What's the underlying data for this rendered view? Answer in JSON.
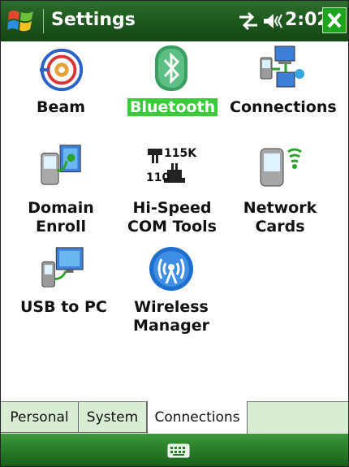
{
  "title_bar": {
    "title": "Settings",
    "clock": "2:02",
    "close_label": "X",
    "icons": [
      "windows-start-icon",
      "connectivity-icon",
      "volume-icon",
      "close-icon"
    ]
  },
  "items": [
    {
      "label_lines": [
        "Beam"
      ],
      "icon": "beam-icon"
    },
    {
      "label_lines": [
        "Bluetooth"
      ],
      "icon": "bluetooth-icon",
      "selected": true
    },
    {
      "label_lines": [
        "Connections"
      ],
      "icon": "connections-icon"
    },
    {
      "label_lines": [
        "Domain",
        "Enroll"
      ],
      "icon": "domain-enroll-icon"
    },
    {
      "label_lines": [
        "Hi-Speed",
        "COM Tools"
      ],
      "icon": "hi-speed-com-tools-icon",
      "icon_text": [
        "115K",
        "110"
      ]
    },
    {
      "label_lines": [
        "Network",
        "Cards"
      ],
      "icon": "network-cards-icon"
    },
    {
      "label_lines": [
        "USB to PC"
      ],
      "icon": "usb-to-pc-icon"
    },
    {
      "label_lines": [
        "Wireless",
        "Manager"
      ],
      "icon": "wireless-manager-icon"
    }
  ],
  "tabs": [
    {
      "label": "Personal"
    },
    {
      "label": "System"
    },
    {
      "label": "Connections",
      "active": true
    }
  ],
  "bottom_bar": {
    "icon": "keyboard-icon"
  },
  "colors": {
    "title_bar": "#1f5a1f",
    "selection": "#3cc93c",
    "tab_bar": "#d8edd3",
    "bottom_bar": "#2a7f2a"
  }
}
